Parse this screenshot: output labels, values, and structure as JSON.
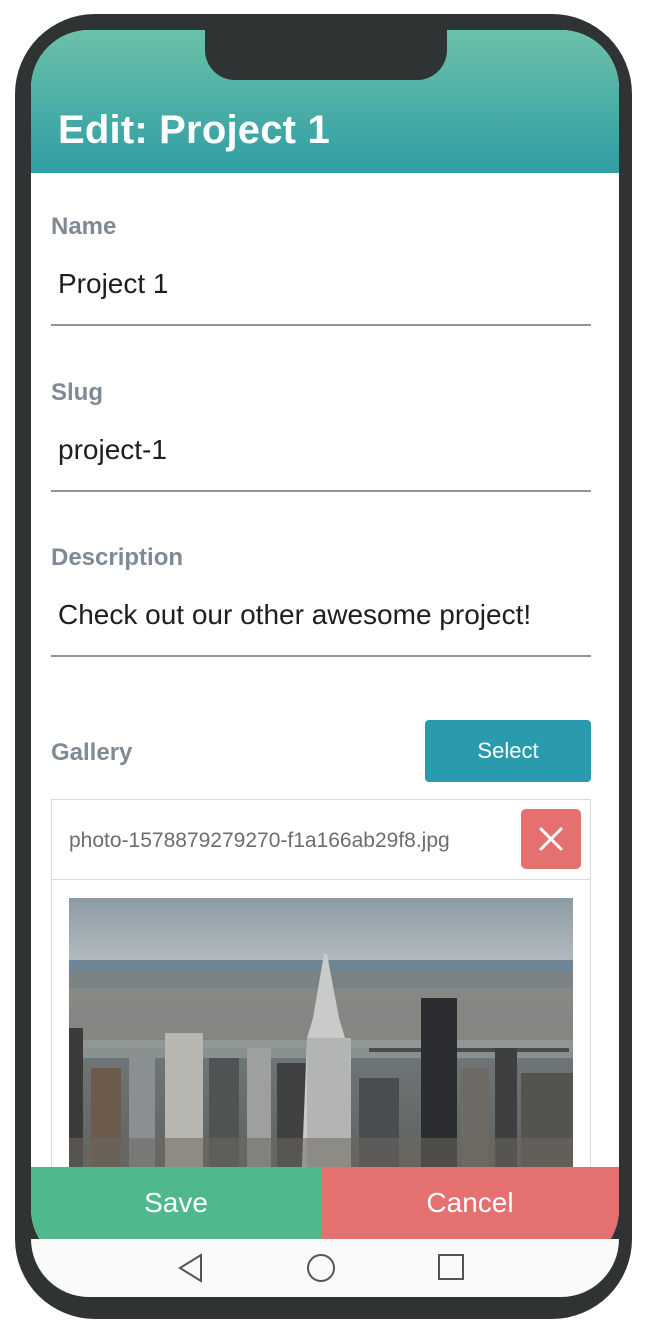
{
  "header": {
    "title": "Edit: Project 1"
  },
  "form": {
    "name": {
      "label": "Name",
      "value": "Project 1"
    },
    "slug": {
      "label": "Slug",
      "value": "project-1"
    },
    "description": {
      "label": "Description",
      "value": "Check out our other awesome project!"
    },
    "gallery": {
      "label": "Gallery",
      "select_label": "Select",
      "file_name": "photo-1578879279270-f1a166ab29f8.jpg"
    }
  },
  "actions": {
    "save_label": "Save",
    "cancel_label": "Cancel"
  },
  "colors": {
    "header_top": "#6cc1a8",
    "header_bottom": "#2f9da4",
    "save": "#4fb88c",
    "cancel": "#e57070",
    "select": "#2a9bac",
    "label": "#7f8a95"
  },
  "icons": {
    "remove": "close-icon",
    "nav_back": "back-triangle-icon",
    "nav_home": "home-circle-icon",
    "nav_recents": "recents-square-icon"
  }
}
